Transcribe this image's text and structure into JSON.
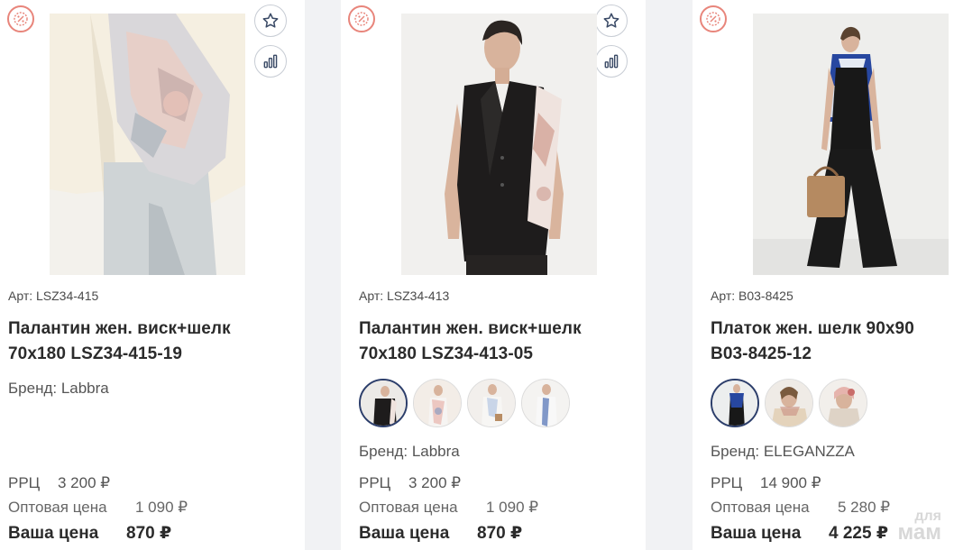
{
  "products": [
    {
      "art": "Арт: LSZ34-415",
      "title_line1": "Палантин жен. виск+шелк",
      "title_line2": "70x180 LSZ34-415-19",
      "brand": "Бренд: Labbra",
      "rrp_label": "РРЦ",
      "rrp_value": "3 200 ₽",
      "wholesale_label": "Оптовая цена",
      "wholesale_value": "1 090 ₽",
      "your_label": "Ваша цена",
      "your_value": "870 ₽"
    },
    {
      "art": "Арт: LSZ34-413",
      "title_line1": "Палантин жен. виск+шелк",
      "title_line2": "70x180 LSZ34-413-05",
      "brand": "Бренд: Labbra",
      "rrp_label": "РРЦ",
      "rrp_value": "3 200 ₽",
      "wholesale_label": "Оптовая цена",
      "wholesale_value": "1 090 ₽",
      "your_label": "Ваша цена",
      "your_value": "870 ₽"
    },
    {
      "art": "Арт: B03-8425",
      "title_line1": "Платок жен. шелк 90x90",
      "title_line2": "B03-8425-12",
      "brand": "Бренд: ELEGANZZA",
      "rrp_label": "РРЦ",
      "rrp_value": "14 900 ₽",
      "wholesale_label": "Оптовая цена",
      "wholesale_value": "5 280 ₽",
      "your_label": "Ваша цена",
      "your_value": "4 225 ₽"
    }
  ],
  "watermark_line1": "для",
  "watermark_line2": "мам",
  "colors": {
    "discount": "#e8857b",
    "border": "#c7ccd4",
    "active_swatch": "#2c3e6b"
  }
}
